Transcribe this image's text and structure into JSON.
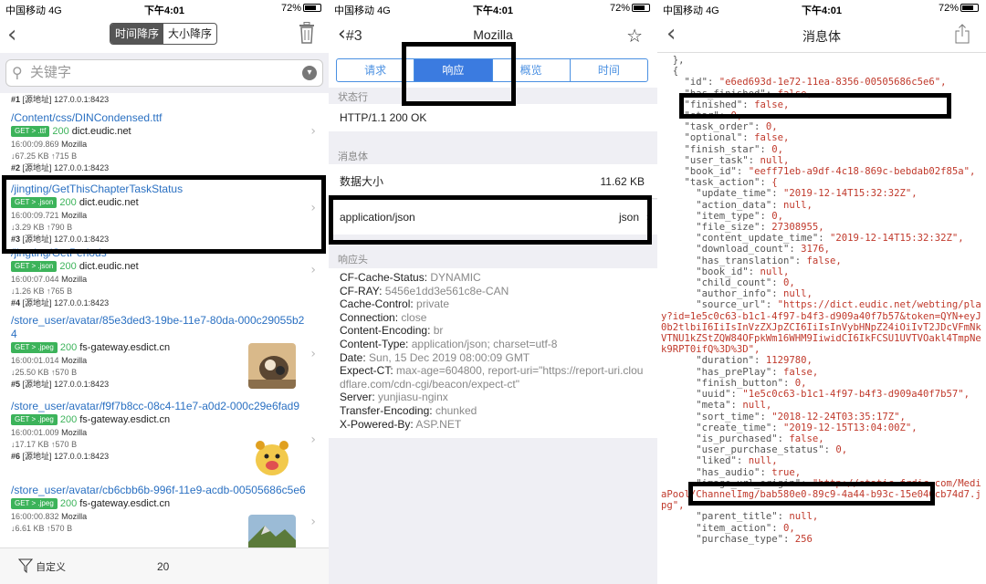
{
  "status": {
    "carrier": "中国移动",
    "network": "4G",
    "time": "下午4:01",
    "battery": "72%"
  },
  "list_screen": {
    "sort_tabs": [
      "时间降序",
      "大小降序"
    ],
    "search_placeholder": "关键字",
    "first_source": {
      "num": "#1",
      "label": "[源地址]",
      "addr": "127.0.0.1:8423"
    },
    "requests": [
      {
        "path": "/Content/css/DINCondensed.ttf",
        "method": "GET > .ttf",
        "code": "200",
        "host": "dict.eudic.net",
        "time": "16:00:09.869",
        "ua": "Mozilla",
        "down": "↓67.25 KB",
        "up": "↑715 B",
        "num": "#2",
        "src": "[源地址]",
        "addr": "127.0.0.1:8423"
      },
      {
        "path": "/jingting/GetThisChapterTaskStatus",
        "method": "GET > .json",
        "code": "200",
        "host": "dict.eudic.net",
        "time": "16:00:09.721",
        "ua": "Mozilla",
        "down": "↓3.29 KB",
        "up": "↑790 B",
        "num": "#3",
        "src": "[源地址]",
        "addr": "127.0.0.1:8423"
      },
      {
        "path": "/jingting/GetPeriods",
        "method": "GET > .json",
        "code": "200",
        "host": "dict.eudic.net",
        "time": "16:00:07.044",
        "ua": "Mozilla",
        "down": "↓1.26 KB",
        "up": "↑765 B",
        "num": "#4",
        "src": "[源地址]",
        "addr": "127.0.0.1:8423"
      },
      {
        "path": "/store_user/avatar/85e3ded3-19be-11e7-80da-000c29055b24",
        "method": "GET > .jpeg",
        "code": "200",
        "host": "fs-gateway.esdict.cn",
        "time": "16:00:01.014",
        "ua": "Mozilla",
        "down": "↓25.50 KB",
        "up": "↑570 B",
        "num": "#5",
        "src": "[源地址]",
        "addr": "127.0.0.1:8423"
      },
      {
        "path": "/store_user/avatar/f9f7b8cc-08c4-11e7-a0d2-000c29e6fad9",
        "method": "GET > .jpeg",
        "code": "200",
        "host": "fs-gateway.esdict.cn",
        "time": "16:00:01.009",
        "ua": "Mozilla",
        "down": "↓17.17 KB",
        "up": "↑570 B",
        "num": "#6",
        "src": "[源地址]",
        "addr": "127.0.0.1:8423"
      },
      {
        "path": "/store_user/avatar/cb6cbb6b-996f-11e9-acdb-00505686c5e6",
        "method": "GET > .jpeg",
        "code": "200",
        "host": "fs-gateway.esdict.cn",
        "time": "16:00:00.832",
        "ua": "Mozilla",
        "down": "↓6.61 KB",
        "up": "↑570 B"
      }
    ],
    "tabbar": {
      "filter_label": "自定义",
      "count": "20"
    }
  },
  "detail_screen": {
    "back_label": "#3",
    "title": "Mozilla",
    "tabs": [
      "请求",
      "响应",
      "概览",
      "时间"
    ],
    "status_section": "状态行",
    "status_line": "HTTP/1.1 200 OK",
    "body_section": "消息体",
    "size_label": "数据大小",
    "size_value": "11.62 KB",
    "content_type": "application/json",
    "content_kind": "json",
    "headers_section": "响应头",
    "headers": [
      {
        "k": "CF-Cache-Status:",
        "v": "DYNAMIC"
      },
      {
        "k": "CF-RAY:",
        "v": "5456e1dd3e561c8e-CAN"
      },
      {
        "k": "Cache-Control:",
        "v": "private"
      },
      {
        "k": "Connection:",
        "v": "close"
      },
      {
        "k": "Content-Encoding:",
        "v": "br"
      },
      {
        "k": "Content-Type:",
        "v": "application/json; charset=utf-8"
      },
      {
        "k": "Date:",
        "v": "Sun, 15 Dec 2019 08:00:09 GMT"
      },
      {
        "k": "Expect-CT:",
        "v": "max-age=604800, report-uri=\"https://report-uri.cloudflare.com/cdn-cgi/beacon/expect-ct\""
      },
      {
        "k": "Server:",
        "v": "yunjiasu-nginx"
      },
      {
        "k": "Transfer-Encoding:",
        "v": "chunked"
      },
      {
        "k": "X-Powered-By:",
        "v": "ASP.NET"
      }
    ]
  },
  "body_screen": {
    "title": "消息体",
    "json_lines": [
      [
        "  },",
        ""
      ],
      [
        "  {",
        ""
      ],
      [
        "    \"id\": ",
        "\"e6ed693d-1e72-11ea-8356-00505686c5e6\","
      ],
      [
        "    \"has_finished\": ",
        "false,"
      ],
      [
        "    \"finished\": ",
        "false,"
      ],
      [
        "    \"star\": ",
        "0,"
      ],
      [
        "    \"task_order\": ",
        "0,"
      ],
      [
        "    \"optional\": ",
        "false,"
      ],
      [
        "    \"finish_star\": ",
        "0,"
      ],
      [
        "    \"user_task\": ",
        "null,"
      ],
      [
        "    \"book_id\": ",
        "\"eeff71eb-a9df-4c18-869c-bebdab02f85a\","
      ],
      [
        "    \"task_action\": ",
        "{"
      ],
      [
        "      \"update_time\": ",
        "\"2019-12-14T15:32:32Z\","
      ],
      [
        "      \"action_data\": ",
        "null,"
      ],
      [
        "      \"item_type\": ",
        "0,"
      ],
      [
        "      \"file_size\": ",
        "27308955,"
      ],
      [
        "      \"content_update_time\": ",
        "\"2019-12-14T15:32:32Z\","
      ],
      [
        "      \"download_count\": ",
        "3176,"
      ],
      [
        "      \"has_translation\": ",
        "false,"
      ],
      [
        "      \"book_id\": ",
        "null,"
      ],
      [
        "      \"child_count\": ",
        "0,"
      ],
      [
        "      \"author_info\": ",
        "null,"
      ],
      [
        "      \"source_url\": ",
        "\"https://dict.eudic.net/webting/play?id=1e5c0c63-b1c1-4f97-b4f3-d909a40f7b57&token=QYN+eyJ0b2tlbiI6IiIsInVzZXJpZCI6IiIsInVybHNpZ24iOiIvT2JDcVFmNkVTNU1kZStZQW84OFpkWm16WHM9IiwidCI6IkFCSU1UVTVOakl4TmpNek9RPT0ifQ%3D%3D\","
      ],
      [
        "      \"duration\": ",
        "1129780,"
      ],
      [
        "      \"has_prePlay\": ",
        "false,"
      ],
      [
        "      \"finish_button\": ",
        "0,"
      ],
      [
        "      \"uuid\": ",
        "\"1e5c0c63-b1c1-4f97-b4f3-d909a40f7b57\","
      ],
      [
        "      \"meta\": ",
        "null,"
      ],
      [
        "      \"sort_time\": ",
        "\"2018-12-24T03:35:17Z\","
      ],
      [
        "      \"create_time\": ",
        "\"2019-12-15T13:04:00Z\","
      ],
      [
        "      \"is_purchased\": ",
        "false,"
      ],
      [
        "      \"user_purchase_status\": ",
        "0,"
      ],
      [
        "      \"liked\": ",
        "null,"
      ],
      [
        "      \"has_audio\": ",
        "true,"
      ],
      [
        "      \"image_url_origin\": ",
        "\"http://static.frdic.com/MediaPool/ChannelImg/bab580e0-89c9-4a44-b93c-15e046cb74d7.jpg\","
      ],
      [
        "      \"parent_title\": ",
        "null,"
      ],
      [
        "      \"item_action\": ",
        "0,"
      ],
      [
        "      \"purchase_type\": ",
        "256"
      ]
    ]
  }
}
